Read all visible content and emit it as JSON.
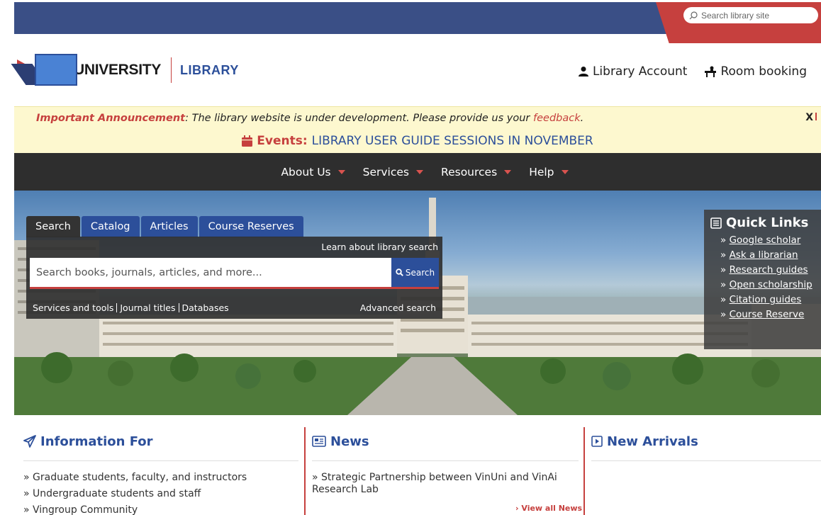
{
  "topbar": {
    "search_placeholder": "Search library site"
  },
  "header": {
    "logo_text": "UNIVERSITY",
    "logo_sub": "LIBRARY",
    "account_label": "Library Account",
    "room_label": "Room booking"
  },
  "announcement": {
    "label": "Important Announcement",
    "text_before": ": The library website is under development. Please provide us your ",
    "link": "feedback",
    "text_after": ".",
    "close": "X"
  },
  "events": {
    "label": "Events:",
    "text": "LIBRARY USER GUIDE SESSIONS IN NOVEMBER"
  },
  "nav": {
    "items": [
      "About Us",
      "Services",
      "Resources",
      "Help"
    ]
  },
  "search": {
    "tabs": [
      "Search",
      "Catalog",
      "Articles",
      "Course Reserves"
    ],
    "active_tab": "Search",
    "learn_link": "Learn about library search",
    "placeholder": "Search books, journals, articles, and more...",
    "button": "Search",
    "links": [
      "Services and tools",
      "Journal titles",
      "Databases"
    ],
    "advanced": "Advanced search"
  },
  "quick_links": {
    "title": "Quick Links",
    "items": [
      "Google scholar",
      "Ask a librarian",
      "Research guides",
      "Open scholarship",
      "Citation guides",
      "Course Reserve"
    ]
  },
  "info_for": {
    "title": "Information For",
    "items": [
      "Graduate students, faculty, and instructors",
      "Undergraduate students and staff",
      "Vingroup Community"
    ]
  },
  "news": {
    "title": "News",
    "items": [
      "Strategic Partnership between VinUni and VinAi Research Lab"
    ],
    "view_all": "View all News"
  },
  "arrivals": {
    "title": "New Arrivals"
  },
  "colors": {
    "navy": "#3a4f86",
    "red": "#c6403e",
    "link_blue": "#2c4f9a",
    "announce_bg": "#fdf8cf",
    "nav_bg": "#2e2e2e"
  }
}
